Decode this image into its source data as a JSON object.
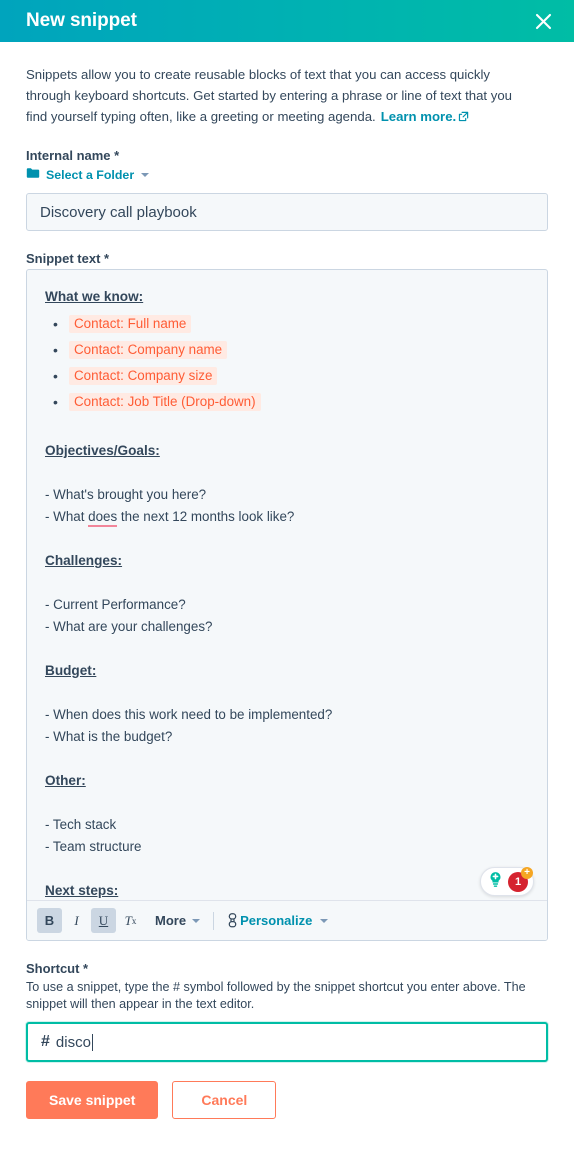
{
  "header": {
    "title": "New snippet",
    "close_icon": "close-icon",
    "gradient_start": "#00a4bd",
    "gradient_end": "#00bda5"
  },
  "intro": {
    "text": "Snippets allow you to create reusable blocks of text that you can access quickly through keyboard shortcuts. Get started by entering a phrase or line of text that you find yourself typing often, like a greeting or meeting agenda.",
    "link_label": "Learn more.",
    "link_icon": "external-link-icon",
    "link_color": "#0091ae"
  },
  "internal_name": {
    "label": "Internal name *",
    "folder_icon": "folder-icon",
    "folder_label": "Select a Folder",
    "folder_caret_icon": "chevron-down-icon",
    "value": "Discovery call playbook",
    "placeholder": ""
  },
  "snippet_text": {
    "label": "Snippet text *",
    "blocks": [
      {
        "type": "heading",
        "text": "What we know:"
      },
      {
        "type": "tokens",
        "items": [
          "Contact: Full name",
          "Contact: Company name",
          "Contact: Company size",
          "Contact: Job Title (Drop-down)"
        ]
      },
      {
        "type": "heading",
        "text": "Objectives/Goals:"
      },
      {
        "type": "line",
        "text": "- What's brought you here?"
      },
      {
        "type": "line_misspell",
        "pre": "- What ",
        "word": "does",
        "post": " the next 12 months look like?"
      },
      {
        "type": "heading",
        "text": "Challenges:"
      },
      {
        "type": "line",
        "text": "- Current Performance?"
      },
      {
        "type": "line",
        "text": "- What are your challenges?"
      },
      {
        "type": "heading",
        "text": "Budget:"
      },
      {
        "type": "line",
        "text": "- When does this work need to be implemented?"
      },
      {
        "type": "line",
        "text": "- What is the budget?"
      },
      {
        "type": "heading",
        "text": "Other:"
      },
      {
        "type": "line",
        "text": "- Tech stack"
      },
      {
        "type": "line",
        "text": "- Team structure"
      },
      {
        "type": "heading",
        "text": "Next steps:"
      }
    ],
    "token_text_color": "#ff5c35",
    "token_bg_color": "#ffeae3"
  },
  "toolbar": {
    "bold_label": "B",
    "bold_icon": "bold-icon",
    "bold_active": true,
    "italic_label": "I",
    "italic_icon": "italic-icon",
    "italic_active": false,
    "underline_label": "U",
    "underline_icon": "underline-icon",
    "underline_active": true,
    "clear_format_label": "T",
    "clear_format_sub": "x",
    "clear_format_icon": "clear-formatting-icon",
    "more_label": "More",
    "more_caret_icon": "chevron-down-icon",
    "link_icon": "link-icon",
    "personalize_label": "Personalize",
    "personalize_caret_icon": "chevron-down-icon"
  },
  "suggestion_pill": {
    "bulb_icon": "lightbulb-icon",
    "count": "1",
    "plus_icon": "plus-icon",
    "bulb_color": "#00bda5",
    "badge_color": "#d5232f",
    "plus_color": "#f5a623"
  },
  "shortcut": {
    "label": "Shortcut *",
    "helper": "To use a snippet, type the # symbol followed by the snippet shortcut you enter above. The snippet will then appear in the text editor.",
    "hash": "#",
    "value": "disco",
    "placeholder": "",
    "focus_color": "#00bda5"
  },
  "footer": {
    "save_label": "Save snippet",
    "cancel_label": "Cancel",
    "primary_color": "#ff7a59"
  }
}
